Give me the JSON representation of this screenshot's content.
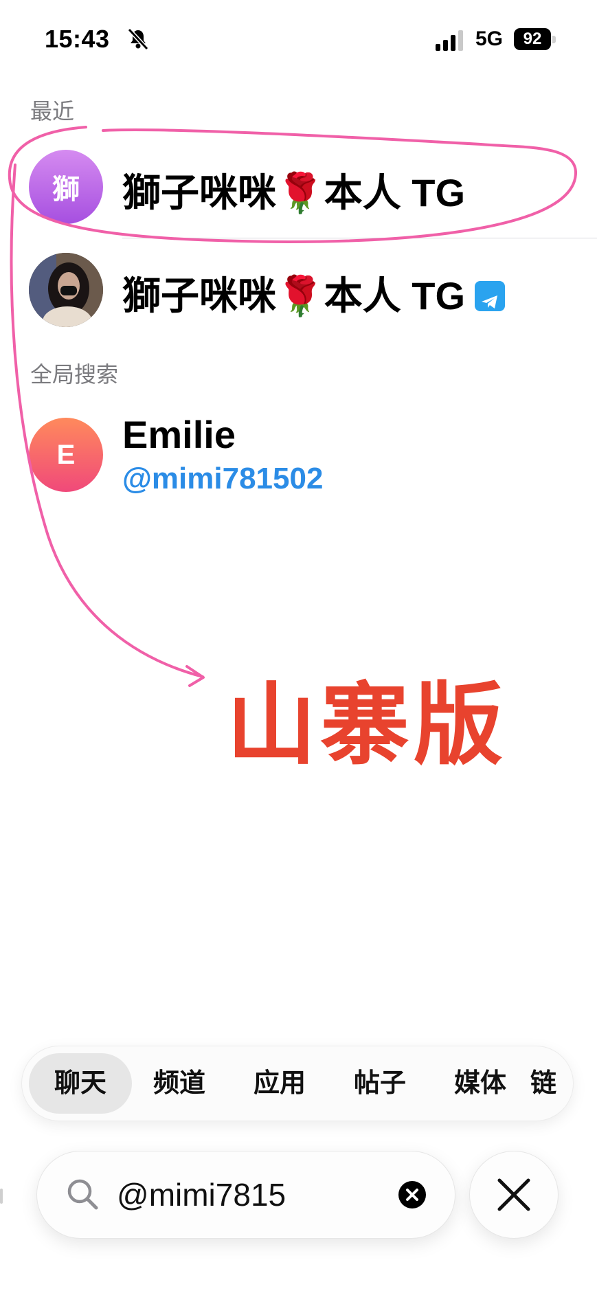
{
  "status_bar": {
    "time": "15:43",
    "network": "5G",
    "battery": "92"
  },
  "recent": {
    "label": "最近",
    "items": [
      {
        "avatar_text": "獅",
        "avatar_colors": [
          "#d58bf0",
          "#a64fe0"
        ],
        "title": "獅子咪咪🌹本人 TG"
      },
      {
        "avatar_icon": "photo-avatar",
        "title": "獅子咪咪🌹本人 TG",
        "badge": "telegram-icon"
      }
    ]
  },
  "global_search": {
    "label": "全局搜索",
    "items": [
      {
        "avatar_text": "E",
        "avatar_colors": [
          "#ff8a5c",
          "#f0497a"
        ],
        "name": "Emilie",
        "handle": "@mimi781502"
      }
    ]
  },
  "annotation": {
    "text": "山寨版",
    "color": "#e8432e",
    "stroke_color": "#f060a8"
  },
  "tabs": [
    "聊天",
    "频道",
    "应用",
    "帖子",
    "媒体",
    "链"
  ],
  "search": {
    "value": "@mimi7815"
  },
  "colors": {
    "link_blue": "#2b8ce6",
    "telegram_blue": "#2aa3ef"
  }
}
